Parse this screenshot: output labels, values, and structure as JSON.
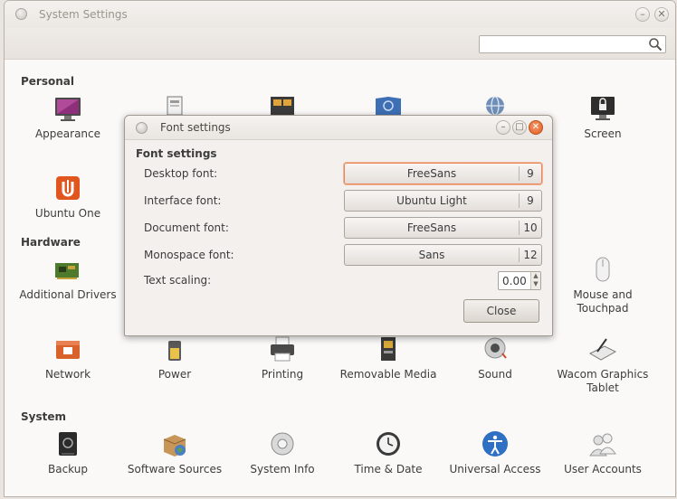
{
  "window": {
    "title": "System Settings",
    "minimize_glyph": "–",
    "close_glyph": "✕"
  },
  "search": {
    "placeholder": "",
    "icon": "search-icon"
  },
  "sections": {
    "personal": "Personal",
    "hardware": "Hardware",
    "system": "System"
  },
  "personal_items": [
    {
      "label": "Appearance",
      "icon": "appearance-icon"
    },
    {
      "label": "",
      "icon": "brightness-lock-icon"
    },
    {
      "label": "",
      "icon": "language-support-icon"
    },
    {
      "label": "",
      "icon": "online-accounts-icon"
    },
    {
      "label": "",
      "icon": "privacy-icon"
    },
    {
      "label": "Screen",
      "icon": "screen-lock-icon"
    },
    {
      "label": "Ubuntu One",
      "icon": "ubuntu-one-icon"
    }
  ],
  "hardware_items": [
    {
      "label": "Additional Drivers",
      "icon": "additional-drivers-icon"
    },
    {
      "label": "Mouse and Touchpad",
      "icon": "mouse-icon"
    },
    {
      "label": "Network",
      "icon": "network-icon"
    },
    {
      "label": "Power",
      "icon": "power-icon"
    },
    {
      "label": "Printing",
      "icon": "printer-icon"
    },
    {
      "label": "Removable Media",
      "icon": "removable-media-icon"
    },
    {
      "label": "Sound",
      "icon": "sound-icon"
    },
    {
      "label": "Wacom Graphics Tablet",
      "icon": "wacom-tablet-icon"
    }
  ],
  "system_items": [
    {
      "label": "Backup",
      "icon": "backup-icon"
    },
    {
      "label": "Software Sources",
      "icon": "software-sources-icon"
    },
    {
      "label": "System Info",
      "icon": "system-info-icon"
    },
    {
      "label": "Time & Date",
      "icon": "clock-icon"
    },
    {
      "label": "Universal Access",
      "icon": "universal-access-icon"
    },
    {
      "label": "User Accounts",
      "icon": "user-accounts-icon"
    }
  ],
  "dialog": {
    "title": "Font settings",
    "heading": "Font settings",
    "rows": [
      {
        "label": "Desktop font:",
        "font": "FreeSans",
        "size": "9"
      },
      {
        "label": "Interface font:",
        "font": "Ubuntu Light",
        "size": "9"
      },
      {
        "label": "Document font:",
        "font": "FreeSans",
        "size": "10"
      },
      {
        "label": "Monospace font:",
        "font": "Sans",
        "size": "12"
      }
    ],
    "scaling_label": "Text scaling:",
    "scaling_value": "0.00",
    "close_label": "Close",
    "minimize_glyph": "–",
    "maximize_glyph": "□",
    "close_glyph": "✕"
  },
  "colors": {
    "accent": "#df5a22",
    "focus_ring": "#e8865a",
    "window_bg": "#fbf9f8"
  }
}
